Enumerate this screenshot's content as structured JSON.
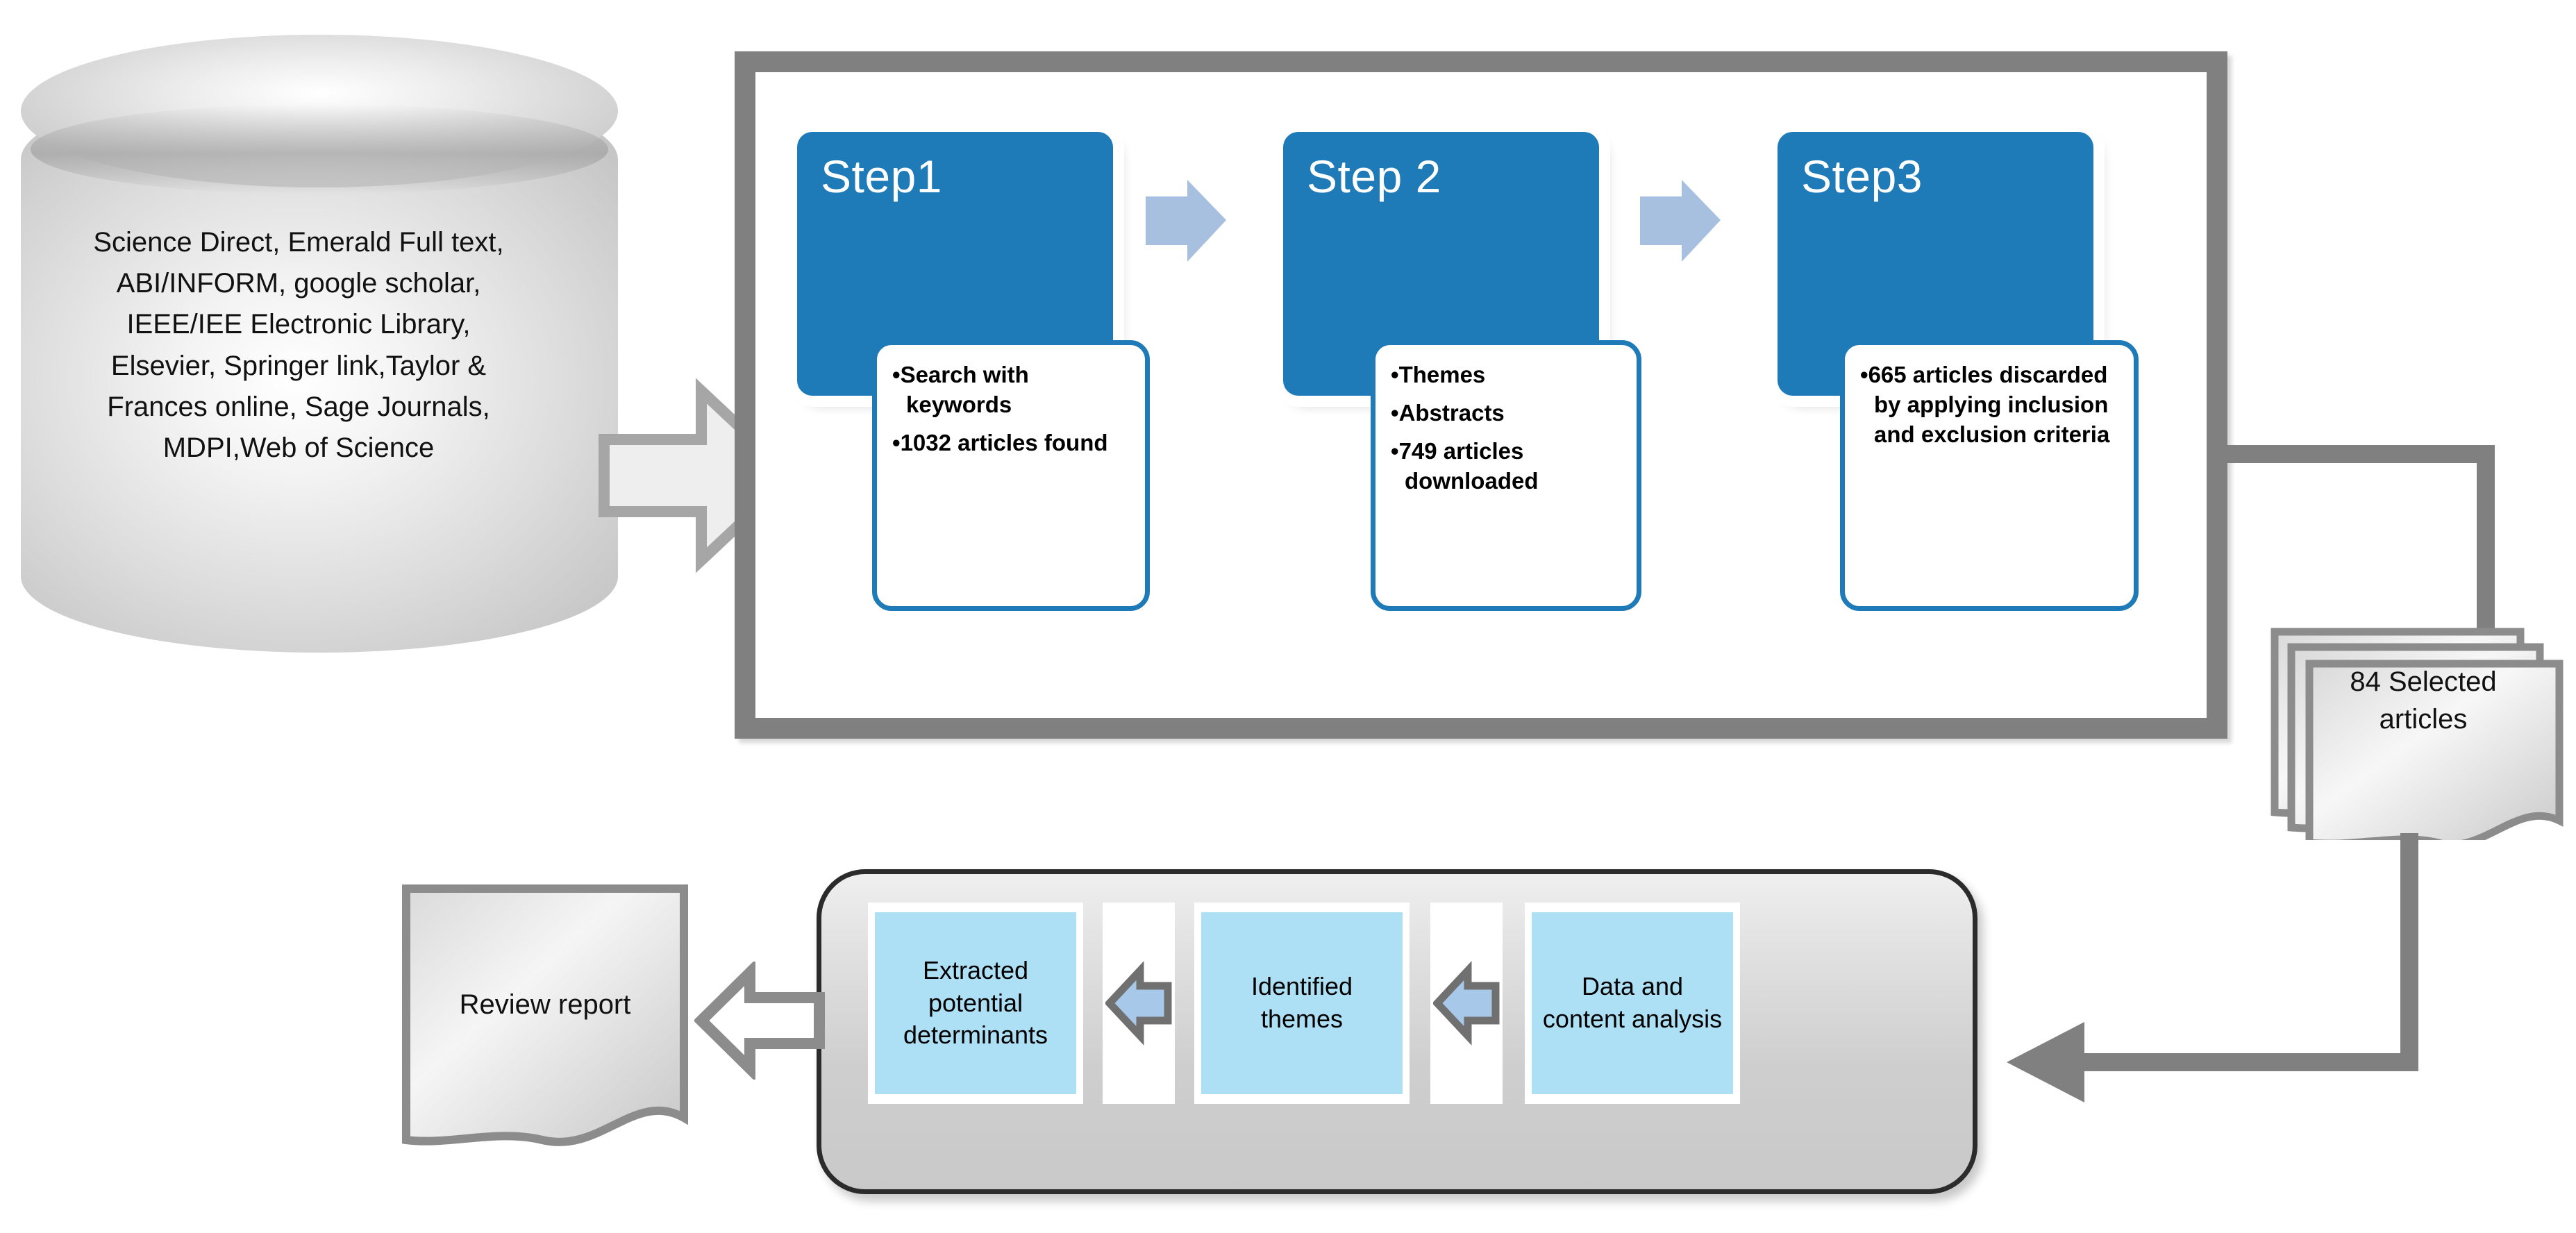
{
  "database": {
    "name": "database-cylinder",
    "lines": [
      "Science Direct, Emerald Full text,",
      "ABI/INFORM, google scholar,",
      "IEEE/IEE Electronic Library,",
      "Elsevier, Springer link,Taylor &",
      "Frances online, Sage Journals,",
      "MDPI,Web of Science"
    ]
  },
  "steps": [
    {
      "label": "Step1",
      "bullets": [
        "Search with keywords",
        "1032 articles found"
      ]
    },
    {
      "label": "Step 2",
      "bullets": [
        "Themes",
        "Abstracts",
        "749 articles downloaded"
      ]
    },
    {
      "label": "Step3",
      "bullets": [
        "665 articles discarded by applying inclusion and  exclusion criteria"
      ]
    }
  ],
  "selected_docs": {
    "line1": "84 Selected",
    "line2": "articles",
    "text": "84 Selected articles"
  },
  "analysis": {
    "cells": [
      {
        "label": "Extracted potential determinants"
      },
      {
        "label": "Identified themes"
      },
      {
        "label": "Data and content analysis"
      }
    ]
  },
  "review_report": {
    "label": "Review report"
  },
  "icons": {
    "arrow_db_to_frame": "right-arrow-icon",
    "arrow_step1_step2": "right-arrow-icon",
    "arrow_step2_step3": "right-arrow-icon",
    "connector_frame_to_docs": "elbow-connector-icon",
    "connector_docs_to_panel": "elbow-arrow-icon",
    "panel_arrow_1": "left-arrow-icon",
    "panel_arrow_2": "left-arrow-icon",
    "arrow_panel_to_report": "left-arrow-icon"
  },
  "colors": {
    "step_blue": "#1f7ab8",
    "callout_border": "#1f7ab8",
    "chevron_blue": "#a8c0e0",
    "cell_blue": "#ade0f5",
    "frame_gray": "#808080",
    "connector_gray": "#808080",
    "panel_border": "#2b2b2b"
  }
}
